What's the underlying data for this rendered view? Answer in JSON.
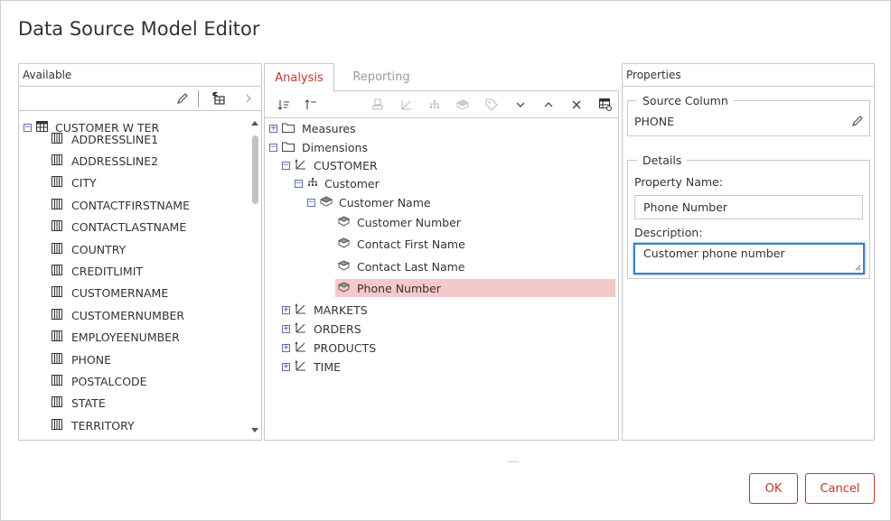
{
  "dialog": {
    "title": "Data Source Model Editor"
  },
  "available": {
    "header": "Available",
    "root": "CUSTOMER W TER",
    "columns": [
      "ADDRESSLINE1",
      "ADDRESSLINE2",
      "CITY",
      "CONTACTFIRSTNAME",
      "CONTACTLASTNAME",
      "COUNTRY",
      "CREDITLIMIT",
      "CUSTOMERNAME",
      "CUSTOMERNUMBER",
      "EMPLOYEENUMBER",
      "PHONE",
      "POSTALCODE",
      "STATE",
      "TERRITORY"
    ]
  },
  "tabs": {
    "analysis": "Analysis",
    "reporting": "Reporting"
  },
  "model_tree": {
    "measures": "Measures",
    "dimensions": "Dimensions",
    "customer_dim": "CUSTOMER",
    "customer_hier": "Customer",
    "customer_level": "Customer Name",
    "properties": [
      "Customer Number",
      "Contact First Name",
      "Contact Last Name",
      "Phone Number"
    ],
    "other_dims": [
      "MARKETS",
      "ORDERS",
      "PRODUCTS",
      "TIME"
    ]
  },
  "properties": {
    "header": "Properties",
    "source_column_legend": "Source Column",
    "source_column_value": "PHONE",
    "details_legend": "Details",
    "property_name_label": "Property Name:",
    "property_name_value": "Phone Number",
    "description_label": "Description:",
    "description_value": "Customer phone number"
  },
  "buttons": {
    "ok": "OK",
    "cancel": "Cancel"
  },
  "colors": {
    "accent": "#c0392b",
    "selection": "#f5c9c9",
    "focus": "#3b82c4"
  }
}
